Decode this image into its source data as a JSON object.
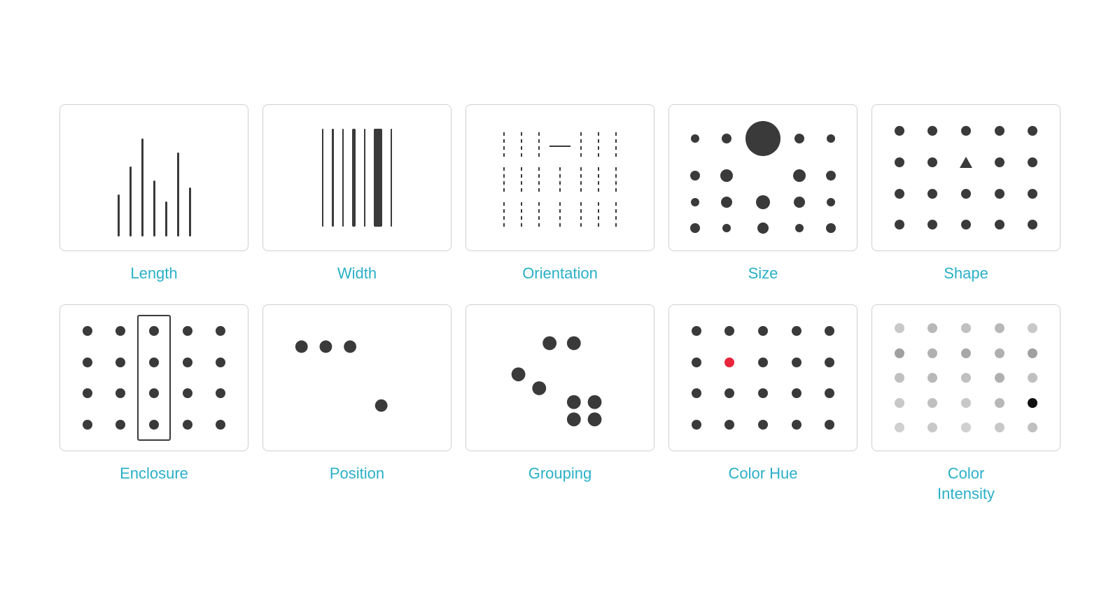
{
  "cards": [
    {
      "id": "length",
      "label": "Length"
    },
    {
      "id": "width",
      "label": "Width"
    },
    {
      "id": "orientation",
      "label": "Orientation"
    },
    {
      "id": "size",
      "label": "Size"
    },
    {
      "id": "shape",
      "label": "Shape"
    },
    {
      "id": "enclosure",
      "label": "Enclosure"
    },
    {
      "id": "position",
      "label": "Position"
    },
    {
      "id": "grouping",
      "label": "Grouping"
    },
    {
      "id": "color-hue",
      "label": "Color Hue"
    },
    {
      "id": "color-intensity",
      "label": "Color\nIntensity"
    }
  ],
  "colors": {
    "label": "#2ab0c8",
    "dark": "#3a3a3a",
    "border": "#d0d0d0",
    "red": "#e8253a"
  }
}
